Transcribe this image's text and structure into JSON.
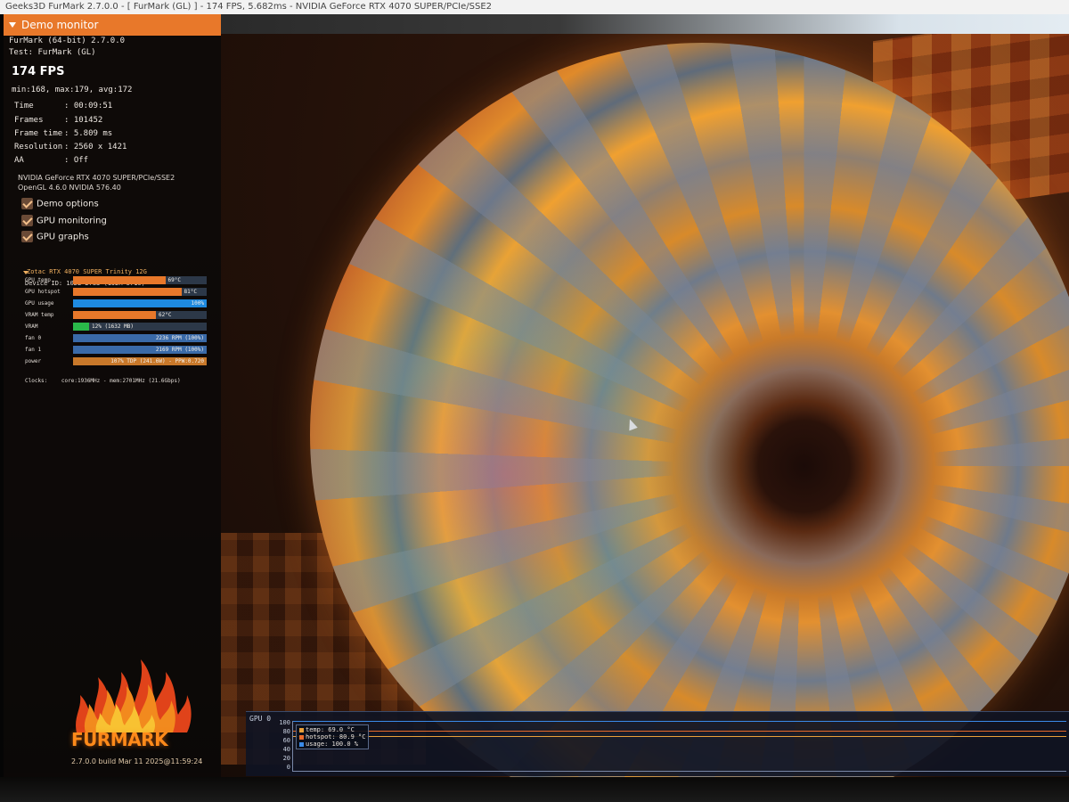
{
  "window": {
    "title": "Geeks3D FurMark 2.7.0.0 - [ FurMark (GL) ] - 174 FPS, 5.682ms - NVIDIA GeForce RTX 4070 SUPER/PCIe/SSE2"
  },
  "demo_monitor": {
    "header": "Demo monitor",
    "app_line": "FurMark (64-bit) 2.7.0.0",
    "test_line": "Test: FurMark (GL)",
    "fps": "174 FPS",
    "fps_stats": "min:168, max:179, avg:172",
    "stats": [
      {
        "name": "Time",
        "value": ": 00:09:51"
      },
      {
        "name": "Frames",
        "value": ": 101452"
      },
      {
        "name": "Frame time",
        "value": ": 5.809 ms"
      },
      {
        "name": "Resolution",
        "value": ": 2560 x 1421"
      },
      {
        "name": "AA",
        "value": ": Off"
      }
    ],
    "gpu_name": "NVIDIA GeForce RTX 4070 SUPER/PCIe/SSE2",
    "opengl": "OpenGL 4.6.0 NVIDIA 576.40",
    "options": [
      {
        "label": "Demo options",
        "checked": true
      },
      {
        "label": "GPU monitoring",
        "checked": true
      },
      {
        "label": "GPU graphs",
        "checked": true
      }
    ],
    "gpu_section": {
      "title": "Zotac RTX 4070 SUPER Trinity 12G",
      "device_id": "Device ID:    10DE-2783 (19DA-5710)",
      "sensors": [
        {
          "label": "GPU temp",
          "text": "69°C",
          "fill": 0.69,
          "color": "#e8782a"
        },
        {
          "label": "GPU hotspot",
          "text": "81°C",
          "fill": 0.81,
          "color": "#e8782a"
        },
        {
          "label": "GPU usage",
          "text": "100%",
          "fill": 1.0,
          "color": "#1e8ae0"
        },
        {
          "label": "VRAM temp",
          "text": "62°C",
          "fill": 0.62,
          "color": "#e8782a"
        },
        {
          "label": "VRAM",
          "text": "12% (1632 MB)",
          "fill": 0.12,
          "color": "#2ab84a"
        },
        {
          "label": "fan 0",
          "text": "2236 RPM (100%)",
          "fill": 1.0,
          "color": "#3a6aa8"
        },
        {
          "label": "fan 1",
          "text": "2169 RPM (100%)",
          "fill": 1.0,
          "color": "#3a6aa8"
        },
        {
          "label": "power",
          "text": "107% TDP (241.6W) - PPW:0.720",
          "fill": 1.0,
          "color": "#c8782a"
        }
      ],
      "clocks_label": "Clocks:",
      "clocks_value": "core:1936MHz - mem:2701MHz (21.6Gbps)"
    }
  },
  "graph": {
    "label": "GPU 0",
    "yticks": [
      "100",
      "80",
      "60",
      "40",
      "20",
      "0"
    ],
    "legend": [
      {
        "label": "temp: 69.0 °C",
        "color": "#e8a03a"
      },
      {
        "label": "hotspot: 80.9 °C",
        "color": "#e86a2a"
      },
      {
        "label": "usage: 100.0 %",
        "color": "#3a8ae8"
      }
    ],
    "series_values": [
      69.0,
      80.9,
      100.0
    ]
  },
  "logo": {
    "text": "FURMARK",
    "build": "2.7.0.0 build Mar 11 2025@11:59:24"
  }
}
